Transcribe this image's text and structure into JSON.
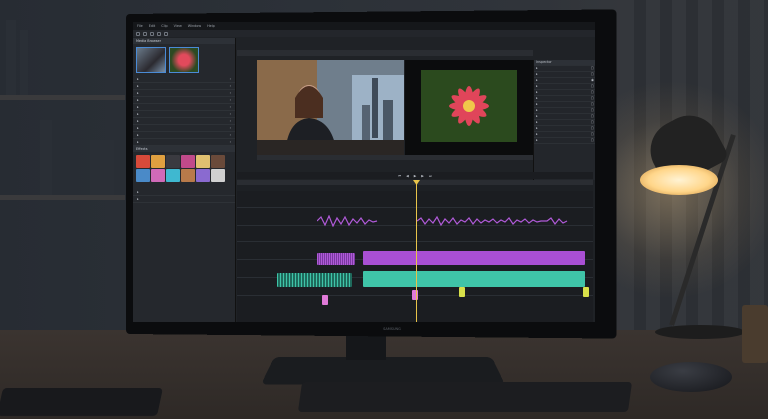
{
  "app": {
    "menu": [
      "File",
      "Edit",
      "Clip",
      "View",
      "Window",
      "Help"
    ],
    "brand": "SAMSUNG"
  },
  "colors": {
    "accent": "#4a8bd6",
    "clip_purple": "#b05ad8",
    "clip_teal": "#3fc4a8",
    "marker_yellow": "#d8e04a",
    "marker_pink": "#e07ad8",
    "playhead": "#e8c44a"
  },
  "left_panel": {
    "title": "Media Browser",
    "items": [
      "",
      "",
      "",
      "",
      "",
      "",
      "",
      "",
      "",
      "",
      ""
    ],
    "effects_title": "Effects"
  },
  "right_panel": {
    "title": "Inspector",
    "rows": [
      "",
      "",
      "",
      "",
      "",
      "",
      "",
      "",
      "",
      "",
      "",
      "",
      "",
      "",
      "",
      "",
      ""
    ]
  },
  "viewers": {
    "left_icon": "video-frame-icon",
    "right_icon": "flower-image-icon"
  },
  "timeline": {
    "tracks": 9
  }
}
